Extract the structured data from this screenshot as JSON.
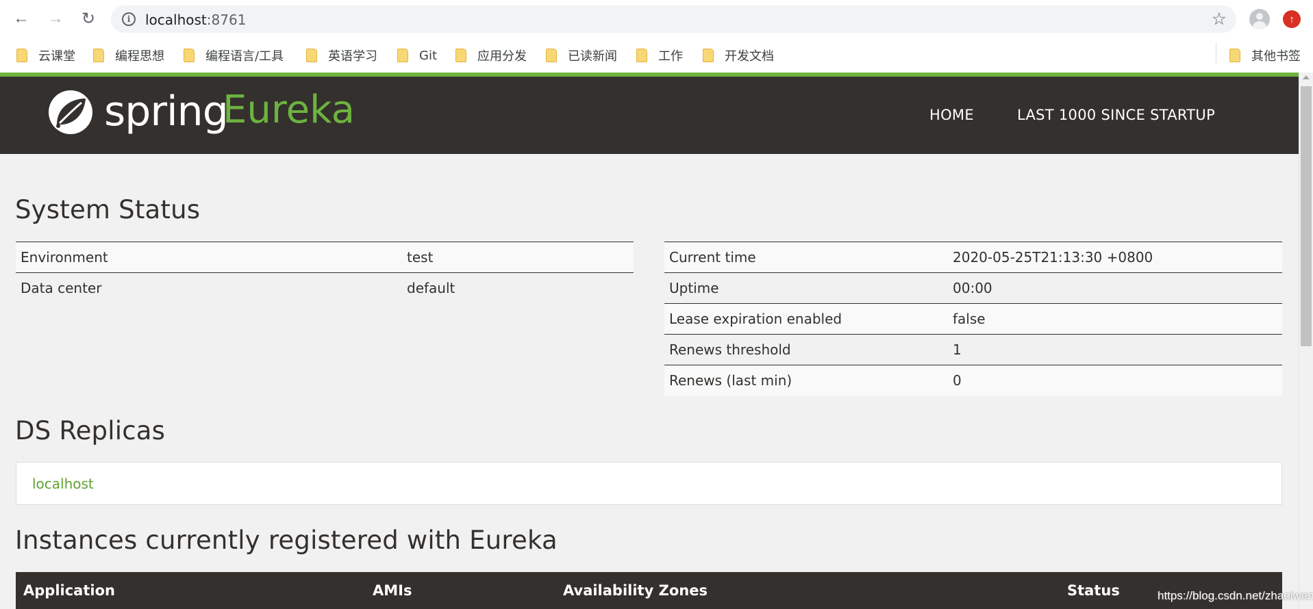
{
  "browser": {
    "url_host": "localhost",
    "url_port": ":8761",
    "bookmarks": [
      "云课堂",
      "编程思想",
      "编程语言/工具",
      "英语学习",
      "Git",
      "应用分发",
      "已读新闻",
      "工作",
      "开发文档"
    ],
    "other_bookmarks": "其他书签"
  },
  "header": {
    "logo_spring": "spring",
    "logo_eureka": "Eureka",
    "nav": [
      "HOME",
      "LAST 1000 SINCE STARTUP"
    ]
  },
  "system_status": {
    "title": "System Status",
    "left": [
      {
        "key": "Environment",
        "value": "test"
      },
      {
        "key": "Data center",
        "value": "default"
      }
    ],
    "right": [
      {
        "key": "Current time",
        "value": "2020-05-25T21:13:30 +0800"
      },
      {
        "key": "Uptime",
        "value": "00:00"
      },
      {
        "key": "Lease expiration enabled",
        "value": "false"
      },
      {
        "key": "Renews threshold",
        "value": "1"
      },
      {
        "key": "Renews (last min)",
        "value": "0"
      }
    ]
  },
  "replicas": {
    "title": "DS Replicas",
    "items": [
      "localhost"
    ]
  },
  "instances": {
    "title": "Instances currently registered with Eureka",
    "columns": [
      "Application",
      "AMIs",
      "Availability Zones",
      "Status"
    ]
  },
  "watermark": "https://blog.csdn.net/zhaolwen",
  "colors": {
    "spring_green": "#6db33f",
    "header_dark": "#34302d",
    "page_bg": "#f1f1f1"
  }
}
